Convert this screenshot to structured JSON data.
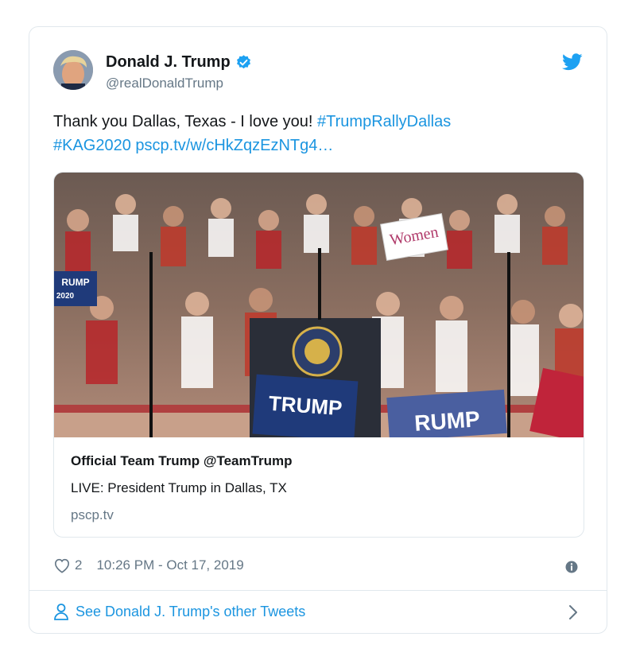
{
  "author": {
    "name": "Donald J. Trump",
    "handle": "@realDonaldTrump"
  },
  "tweet": {
    "text_plain": "Thank you Dallas, Texas - I love you!",
    "hashtag1": "#TrumpRallyDallas",
    "hashtag2": "#KAG2020",
    "link": "pscp.tv/w/cHkZqzEzNTg4…"
  },
  "card": {
    "title": "Official Team Trump @TeamTrump",
    "description": "LIVE: President Trump in Dallas, TX",
    "domain": "pscp.tv",
    "sign_women": "Women",
    "sign_trump": "TRUMP",
    "sign_trump_small": "RUMP",
    "sign_year": "2020"
  },
  "meta": {
    "likes": "2",
    "timestamp": "10:26 PM - Oct 17, 2019"
  },
  "footer": {
    "label": "See Donald J. Trump's other Tweets"
  },
  "colors": {
    "link": "#1b95e0",
    "secondary": "#657786",
    "border": "#e1e8ed"
  },
  "icons": {
    "verified": "verified-badge-icon",
    "bird": "twitter-bird-icon",
    "heart": "heart-icon",
    "info": "info-icon",
    "person": "person-icon",
    "chevron": "chevron-right-icon"
  }
}
